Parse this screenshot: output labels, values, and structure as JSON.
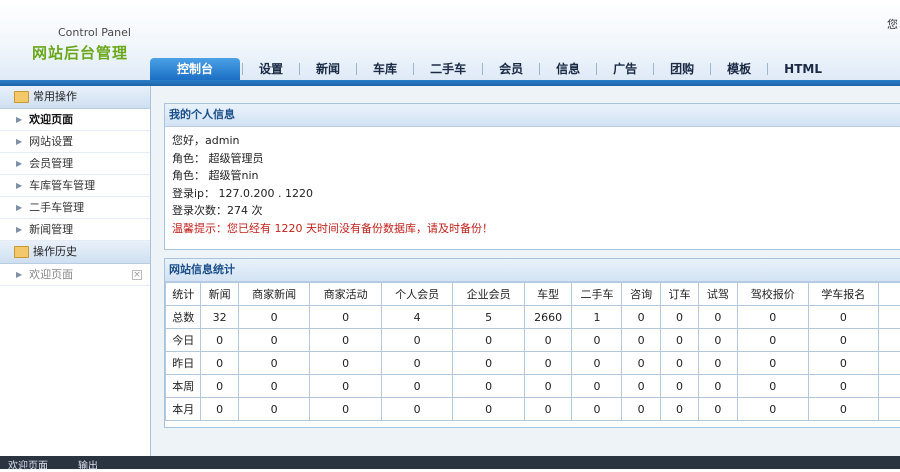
{
  "header": {
    "logo_sub": "Control Panel",
    "logo_main": "网站后台管理",
    "top_right": "您"
  },
  "nav": [
    {
      "label": "控制台",
      "active": true
    },
    {
      "label": "设置"
    },
    {
      "label": "新闻"
    },
    {
      "label": "车库"
    },
    {
      "label": "二手车"
    },
    {
      "label": "会员"
    },
    {
      "label": "信息"
    },
    {
      "label": "广告"
    },
    {
      "label": "团购"
    },
    {
      "label": "模板"
    },
    {
      "label": "HTML"
    }
  ],
  "sidebar": {
    "section1_title": "常用操作",
    "items": [
      "欢迎页面",
      "网站设置",
      "会员管理",
      "车库管车管理",
      "二手车管理",
      "新闻管理"
    ],
    "section2_title": "操作历史",
    "history_items": [
      "欢迎页面"
    ]
  },
  "personal": {
    "title": "我的个人信息",
    "hello": "您好，admin",
    "role1": "角色： 超级管理员",
    "role2": "角色：  超级管nin",
    "login_ip": "登录ip：  127.0.200  .  1220",
    "login_count": "登录次数：274 次",
    "warning": "温馨提示：您已经有  1220 天时间没有备份数据库，请及时备份！"
  },
  "stats": {
    "title": "网站信息统计",
    "headers": [
      "统计",
      "新闻",
      "商家新闻",
      "商家活动",
      "个人会员",
      "企业会员",
      "车型",
      "二手车",
      "咨询",
      "订车",
      "试驾",
      "驾校报价",
      "学车报名"
    ],
    "rows": [
      [
        "总数",
        "32",
        "0",
        "0",
        "4",
        "5",
        "2660",
        "1",
        "0",
        "0",
        "0",
        "0",
        "0"
      ],
      [
        "今日",
        "0",
        "0",
        "0",
        "0",
        "0",
        "0",
        "0",
        "0",
        "0",
        "0",
        "0",
        "0"
      ],
      [
        "昨日",
        "0",
        "0",
        "0",
        "0",
        "0",
        "0",
        "0",
        "0",
        "0",
        "0",
        "0",
        "0"
      ],
      [
        "本周",
        "0",
        "0",
        "0",
        "0",
        "0",
        "0",
        "0",
        "0",
        "0",
        "0",
        "0",
        "0"
      ],
      [
        "本月",
        "0",
        "0",
        "0",
        "0",
        "0",
        "0",
        "0",
        "0",
        "0",
        "0",
        "0",
        "0"
      ]
    ]
  },
  "taskbar": {
    "item1": "欢迎页面",
    "item2": "输出"
  }
}
